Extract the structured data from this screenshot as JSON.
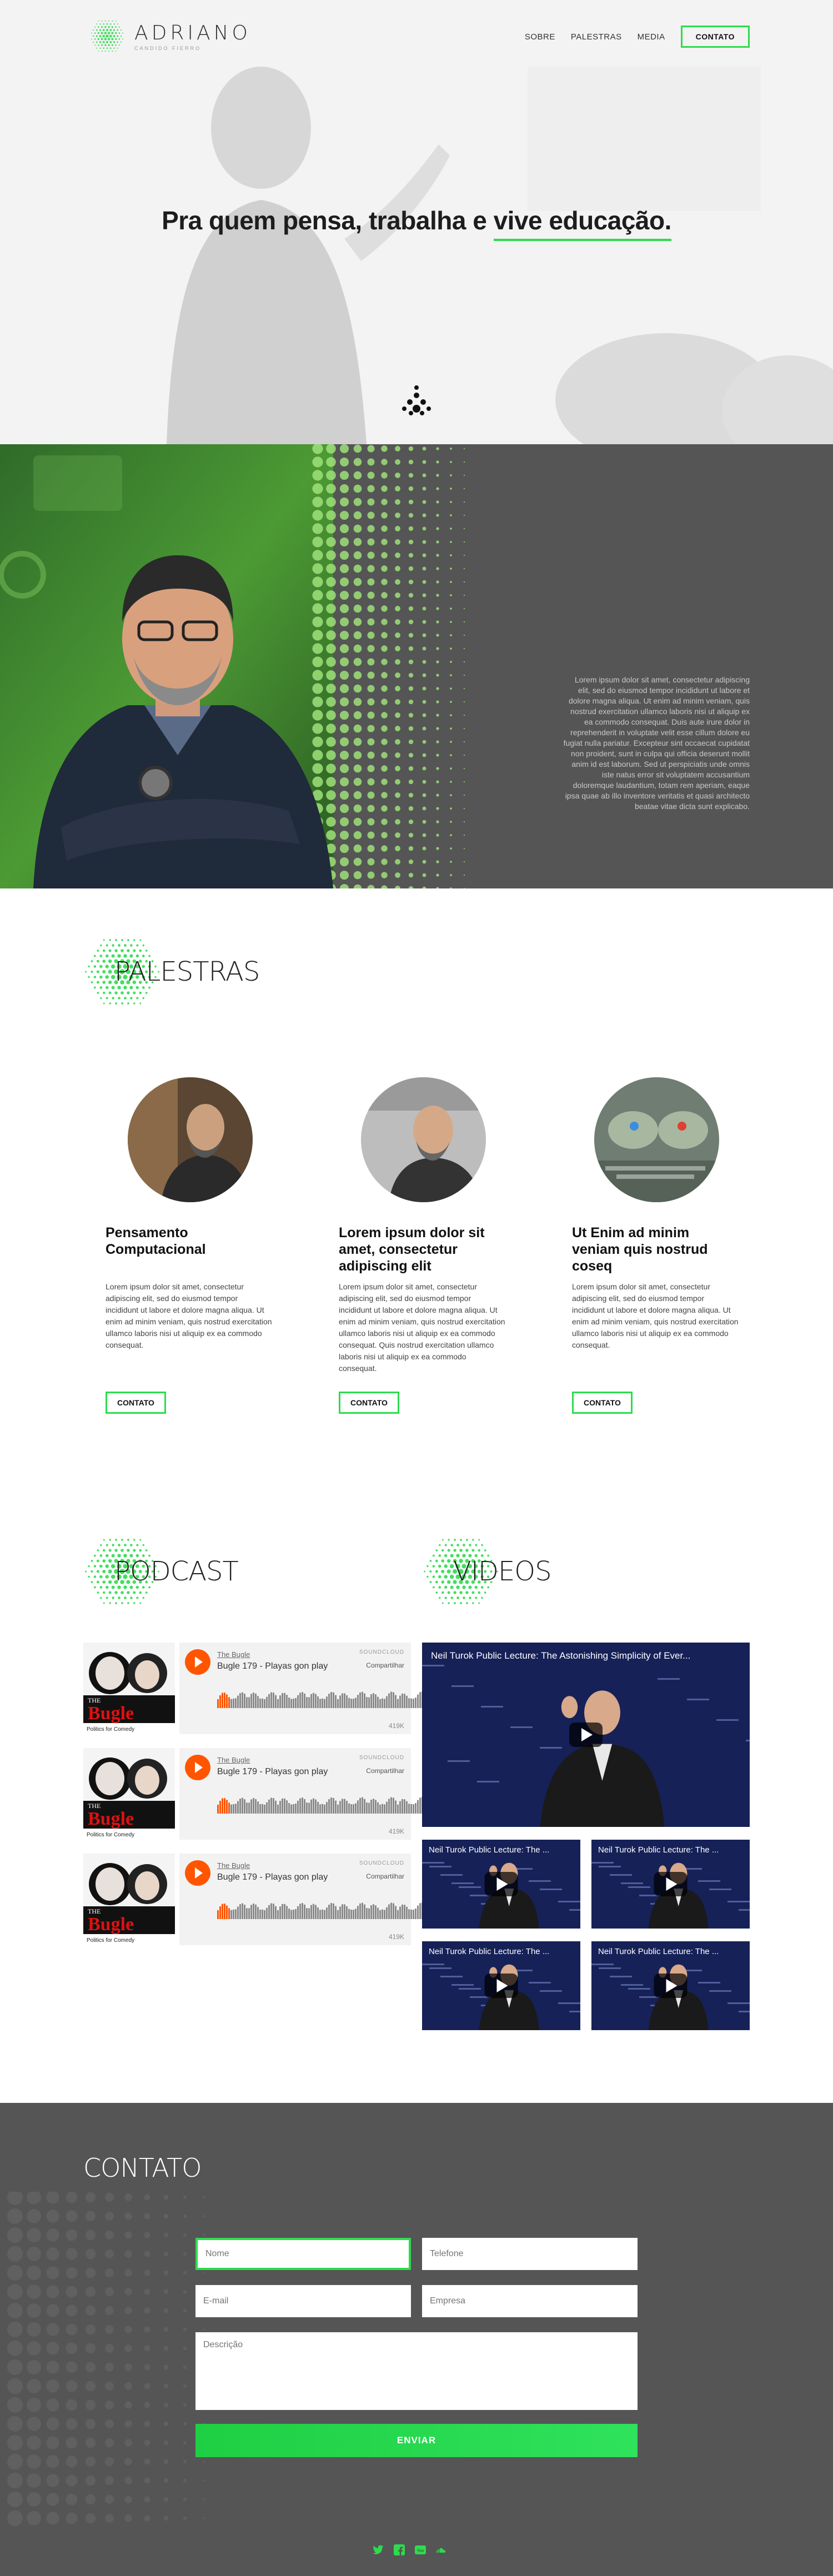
{
  "header": {
    "logo_name": "ADRIANO",
    "logo_sub": "CANDIDO FIERRO",
    "nav": [
      "SOBRE",
      "PALESTRAS",
      "MEDIA"
    ],
    "nav_cta": "CONTATO"
  },
  "hero": {
    "title_pre": "Pra quem pensa, trabalha e ",
    "title_highlight": "vive educação."
  },
  "about": {
    "text": "Lorem ipsum dolor sit amet, consectetur adipiscing elit, sed do eiusmod tempor incididunt ut labore et dolore magna aliqua. Ut enim ad minim veniam, quis nostrud exercitation ullamco laboris nisi ut aliquip ex ea commodo consequat. Duis aute irure dolor in reprehenderit in voluptate velit esse cillum dolore eu fugiat nulla pariatur. Excepteur sint occaecat cupidatat non proident, sunt in culpa qui officia deserunt mollit anim id est laborum. Sed ut perspiciatis unde omnis iste natus error sit voluptatem accusantium doloremque laudantium, totam rem aperiam, eaque ipsa quae ab illo inventore veritatis et quasi architecto beatae vitae dicta sunt explicabo."
  },
  "palestras": {
    "title": "PALESTRAS",
    "cards": [
      {
        "title": "Pensamento Computacional",
        "text": "Lorem ipsum dolor sit amet, consectetur adipiscing elit, sed do eiusmod tempor incididunt ut labore et dolore magna aliqua. Ut enim ad minim veniam, quis nostrud exercitation ullamco laboris nisi ut aliquip ex ea commodo consequat.",
        "button": "CONTATO"
      },
      {
        "title": "Lorem ipsum dolor sit amet, consectetur adipiscing elit",
        "text": "Lorem ipsum dolor sit amet, consectetur adipiscing elit, sed do eiusmod tempor incididunt ut labore et dolore magna aliqua. Ut enim ad minim veniam, quis nostrud exercitation ullamco laboris nisi ut aliquip ex ea commodo consequat. Quis nostrud exercitation ullamco laboris nisi ut aliquip ex ea commodo consequat.",
        "button": "CONTATO"
      },
      {
        "title": "Ut Enim ad minim veniam quis nostrud coseq",
        "text": "Lorem ipsum dolor sit amet, consectetur adipiscing elit, sed do eiusmod tempor incididunt ut labore et dolore magna aliqua. Ut enim ad minim veniam, quis nostrud exercitation ullamco laboris nisi ut aliquip ex ea commodo consequat.",
        "button": "CONTATO"
      }
    ]
  },
  "podcast": {
    "title": "PODCAST",
    "items": [
      {
        "artist": "The Bugle",
        "track": "Bugle 179 - Playas gon play",
        "soundcloud": "SOUNDCLOUD",
        "share": "Compartilhar",
        "plays": "419K",
        "art_caption": "Politics for Comedy"
      },
      {
        "artist": "The Bugle",
        "track": "Bugle 179 - Playas gon play",
        "soundcloud": "SOUNDCLOUD",
        "share": "Compartilhar",
        "plays": "419K",
        "art_caption": "Politics for Comedy"
      },
      {
        "artist": "The Bugle",
        "track": "Bugle 179 - Playas gon play",
        "soundcloud": "SOUNDCLOUD",
        "share": "Compartilhar",
        "plays": "419K",
        "art_caption": "Politics for Comedy"
      }
    ]
  },
  "videos": {
    "title": "VIDEOS",
    "main_title": "Neil Turok Public Lecture: The Astonishing Simplicity of Ever...",
    "small_titles": [
      "Neil Turok Public Lecture: The ...",
      "Neil Turok Public Lecture: The ...",
      "Neil Turok Public Lecture: The ...",
      "Neil Turok Public Lecture: The ..."
    ]
  },
  "contact": {
    "title": "CONTATO",
    "name_placeholder": "Nome",
    "phone_placeholder": "Telefone",
    "email_placeholder": "E-mail",
    "company_placeholder": "Empresa",
    "desc_placeholder": "Descrição",
    "submit": "ENVIAR"
  },
  "social": [
    "twitter-icon",
    "facebook-icon",
    "youtube-icon",
    "soundcloud-icon"
  ],
  "colors": {
    "accent": "#2ddc4d",
    "dark_bg": "#555555",
    "soundcloud": "#ff5500"
  }
}
